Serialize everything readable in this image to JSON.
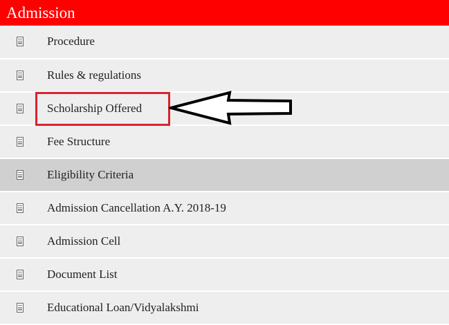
{
  "header": {
    "title": "Admission",
    "color": "#ff0000"
  },
  "menu": {
    "items": [
      {
        "label": "Procedure",
        "icon": "document-icon",
        "active": false,
        "highlighted": false
      },
      {
        "label": "Rules & regulations",
        "icon": "document-icon",
        "active": false,
        "highlighted": false
      },
      {
        "label": "Scholarship Offered",
        "icon": "document-icon",
        "active": false,
        "highlighted": true
      },
      {
        "label": "Fee Structure",
        "icon": "document-icon",
        "active": false,
        "highlighted": false
      },
      {
        "label": "Eligibility Criteria",
        "icon": "document-icon",
        "active": true,
        "highlighted": false
      },
      {
        "label": "Admission Cancellation A.Y. 2018-19",
        "icon": "document-icon",
        "active": false,
        "highlighted": false
      },
      {
        "label": "Admission Cell",
        "icon": "document-icon",
        "active": false,
        "highlighted": false
      },
      {
        "label": "Document List",
        "icon": "document-icon",
        "active": false,
        "highlighted": false
      },
      {
        "label": "Educational Loan/Vidyalakshmi",
        "icon": "document-icon",
        "active": false,
        "highlighted": false
      }
    ]
  },
  "annotation": {
    "shape": "arrow-left",
    "target": "Scholarship Offered",
    "box_color": "#d9232e",
    "arrow_color": "#000000"
  }
}
